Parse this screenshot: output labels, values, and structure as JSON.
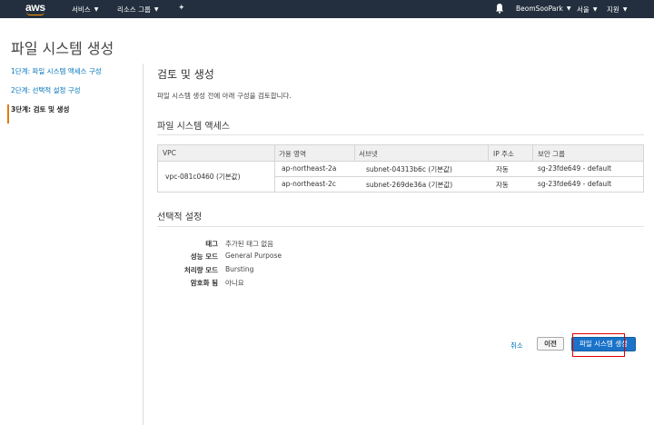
{
  "nav": {
    "logo": "aws",
    "services": "서비스",
    "resource_groups": "리소스 그룹",
    "user": "BeomSooPark",
    "region": "서울",
    "support": "지원"
  },
  "page_title": "파일 시스템 생성",
  "steps": [
    {
      "label": "1단계: 파일 시스템 액세스 구성",
      "active": false
    },
    {
      "label": "2단계: 선택적 설정 구성",
      "active": false
    },
    {
      "label": "3단계: 검토 및 생성",
      "active": true
    }
  ],
  "review": {
    "title": "검토 및 생성",
    "description": "파일 시스템 생성 전에 아래 구성을 검토합니다."
  },
  "access": {
    "title": "파일 시스템 액세스",
    "columns": [
      "VPC",
      "가용 영역",
      "서브넷",
      "IP 주소",
      "보안 그룹"
    ],
    "vpc": "vpc-081c0460 (기본값)",
    "rows": [
      {
        "az": "ap-northeast-2a",
        "subnet": "subnet-04313b6c (기본값)",
        "ip": "자동",
        "sg": "sg-23fde649 - default"
      },
      {
        "az": "ap-northeast-2c",
        "subnet": "subnet-269de36a (기본값)",
        "ip": "자동",
        "sg": "sg-23fde649 - default"
      }
    ]
  },
  "optional": {
    "title": "선택적 설정",
    "items": [
      {
        "key": "태그",
        "value": "추가된 태그 없음"
      },
      {
        "key": "성능 모드",
        "value": "General Purpose"
      },
      {
        "key": "처리량 모드",
        "value": "Bursting"
      },
      {
        "key": "암호화 됨",
        "value": "아니요"
      }
    ]
  },
  "buttons": {
    "cancel": "취소",
    "previous": "이전",
    "create": "파일 시스템 생성"
  },
  "colors": {
    "nav_bg": "#232f3e",
    "accent": "#ff9900",
    "link": "#0073bb",
    "primary_button": "#1a73c9",
    "highlight": "#e00000"
  }
}
